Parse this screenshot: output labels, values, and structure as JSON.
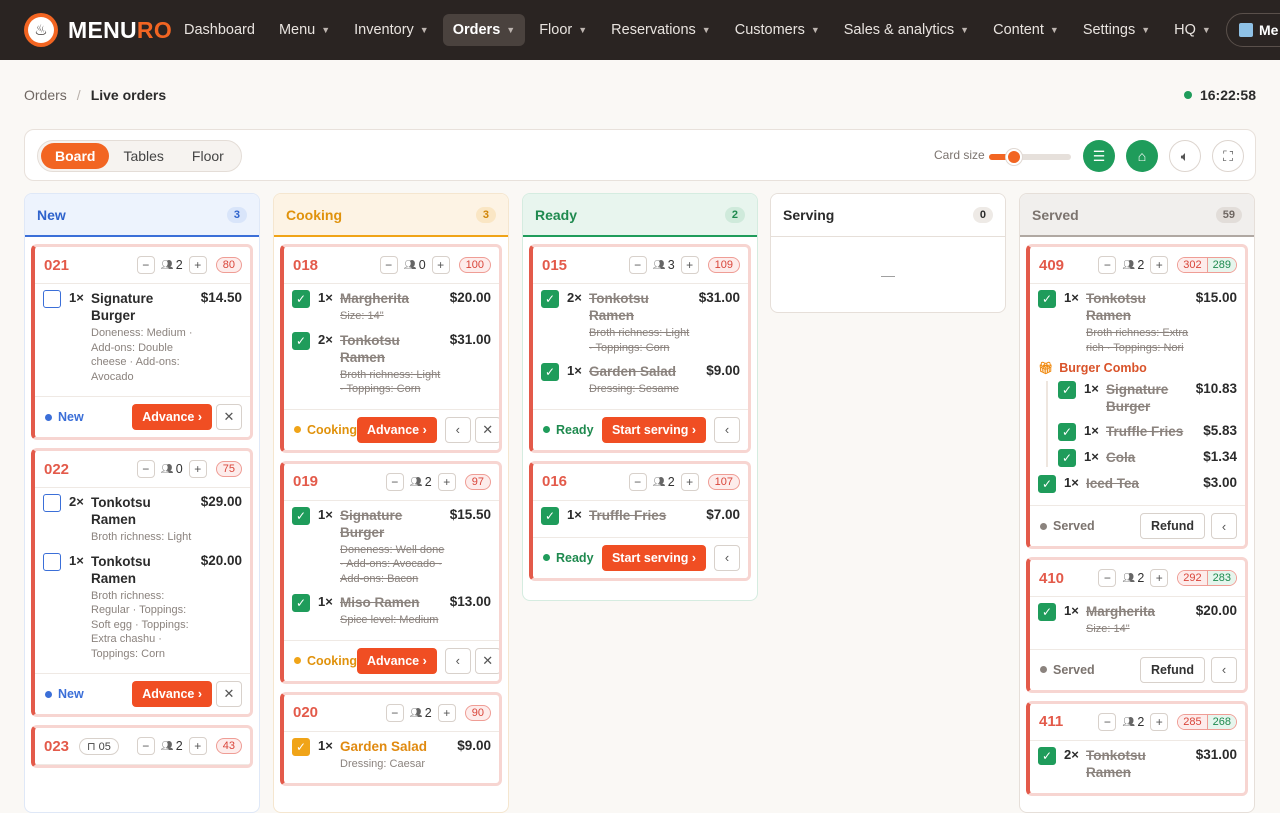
{
  "brand": {
    "name_a": "MENU",
    "name_b": "RO"
  },
  "nav": [
    {
      "label": "Dashboard",
      "chev": false,
      "active": false
    },
    {
      "label": "Menu",
      "chev": true,
      "active": false
    },
    {
      "label": "Inventory",
      "chev": true,
      "active": false
    },
    {
      "label": "Orders",
      "chev": true,
      "active": true
    },
    {
      "label": "Floor",
      "chev": true,
      "active": false
    },
    {
      "label": "Reservations",
      "chev": true,
      "active": false
    },
    {
      "label": "Customers",
      "chev": true,
      "active": false
    },
    {
      "label": "Sales & analytics",
      "chev": true,
      "active": false
    },
    {
      "label": "Content",
      "chev": true,
      "active": false
    },
    {
      "label": "Settings",
      "chev": true,
      "active": false
    },
    {
      "label": "HQ",
      "chev": true,
      "active": false
    }
  ],
  "venue": {
    "label": "Me"
  },
  "breadcrumb": {
    "parent": "Orders",
    "sep": "/",
    "current": "Live orders"
  },
  "clock": "16:22:58",
  "views": {
    "board": "Board",
    "tables": "Tables",
    "floor": "Floor",
    "active": "Board"
  },
  "card_size": {
    "label": "Card size",
    "value": 0.3
  },
  "columns": {
    "new": {
      "title": "New",
      "count": "3"
    },
    "cooking": {
      "title": "Cooking",
      "count": "3"
    },
    "ready": {
      "title": "Ready",
      "count": "2"
    },
    "serving": {
      "title": "Serving",
      "count": "0",
      "empty": "—"
    },
    "served": {
      "title": "Served",
      "count": "59"
    }
  },
  "orders": {
    "o021": {
      "num": "021",
      "guests": "2",
      "timer": "80",
      "status": "New",
      "action": "Advance ›",
      "items": [
        {
          "qty": "1×",
          "name": "Signature Burger",
          "mods": "Doneness: Medium · Add-ons: Double cheese · Add-ons: Avocado",
          "price": "$14.50"
        }
      ]
    },
    "o022": {
      "num": "022",
      "guests": "0",
      "timer": "75",
      "status": "New",
      "action": "Advance ›",
      "items": [
        {
          "qty": "2×",
          "name": "Tonkotsu Ramen",
          "mods": "Broth richness: Light",
          "price": "$29.00"
        },
        {
          "qty": "1×",
          "name": "Tonkotsu Ramen",
          "mods": "Broth richness: Regular · Toppings: Soft egg · Toppings: Extra chashu · Toppings: Corn",
          "price": "$20.00"
        }
      ]
    },
    "o023": {
      "num": "023",
      "table": "05",
      "guests": "2",
      "timer": "43"
    },
    "o018": {
      "num": "018",
      "guests": "0",
      "timer": "100",
      "status": "Cooking",
      "action": "Advance ›",
      "items": [
        {
          "qty": "1×",
          "name": "Margherita",
          "mods": "Size: 14\"",
          "price": "$20.00"
        },
        {
          "qty": "2×",
          "name": "Tonkotsu Ramen",
          "mods": "Broth richness: Light · Toppings: Corn",
          "price": "$31.00"
        }
      ]
    },
    "o019": {
      "num": "019",
      "guests": "2",
      "timer": "97",
      "status": "Cooking",
      "action": "Advance ›",
      "items": [
        {
          "qty": "1×",
          "name": "Signature Burger",
          "mods": "Doneness: Well done · Add-ons: Avocado · Add-ons: Bacon",
          "price": "$15.50"
        },
        {
          "qty": "1×",
          "name": "Miso Ramen",
          "mods": "Spice level: Medium",
          "price": "$13.00"
        }
      ]
    },
    "o020": {
      "num": "020",
      "guests": "2",
      "timer": "90",
      "items": [
        {
          "qty": "1×",
          "name": "Garden Salad",
          "mods": "Dressing: Caesar",
          "price": "$9.00"
        }
      ]
    },
    "o015": {
      "num": "015",
      "guests": "3",
      "timer": "109",
      "status": "Ready",
      "action": "Start serving ›",
      "items": [
        {
          "qty": "2×",
          "name": "Tonkotsu Ramen",
          "mods": "Broth richness: Light · Toppings: Corn",
          "price": "$31.00"
        },
        {
          "qty": "1×",
          "name": "Garden Salad",
          "mods": "Dressing: Sesame",
          "price": "$9.00"
        }
      ]
    },
    "o016": {
      "num": "016",
      "guests": "2",
      "timer": "107",
      "status": "Ready",
      "action": "Start serving ›",
      "items": [
        {
          "qty": "1×",
          "name": "Truffle Fries",
          "mods": "",
          "price": "$7.00"
        }
      ]
    },
    "o409": {
      "num": "409",
      "guests": "2",
      "timer_a": "302",
      "timer_b": "289",
      "status": "Served",
      "action": "Refund",
      "items": [
        {
          "qty": "1×",
          "name": "Tonkotsu Ramen",
          "mods": "Broth richness: Extra rich · Toppings: Nori",
          "price": "$15.00"
        }
      ],
      "combo": {
        "label": "Burger Combo",
        "items": [
          {
            "qty": "1×",
            "name": "Signature Burger",
            "price": "$10.83"
          },
          {
            "qty": "1×",
            "name": "Truffle Fries",
            "price": "$5.83"
          },
          {
            "qty": "1×",
            "name": "Cola",
            "price": "$1.34"
          }
        ]
      },
      "extra": {
        "qty": "1×",
        "name": "Iced Tea",
        "price": "$3.00"
      }
    },
    "o410": {
      "num": "410",
      "guests": "2",
      "timer_a": "292",
      "timer_b": "283",
      "status": "Served",
      "action": "Refund",
      "items": [
        {
          "qty": "1×",
          "name": "Margherita",
          "mods": "Size: 14\"",
          "price": "$20.00"
        }
      ]
    },
    "o411": {
      "num": "411",
      "guests": "2",
      "timer_a": "285",
      "timer_b": "268",
      "items": [
        {
          "qty": "2×",
          "name": "Tonkotsu Ramen",
          "mods": "",
          "price": "$31.00"
        }
      ]
    }
  },
  "colors": {
    "accent": "#f26522",
    "new": "#3b6fd8",
    "cooking": "#f0a418",
    "ready": "#1f9c5b",
    "served": "#8b837e"
  }
}
